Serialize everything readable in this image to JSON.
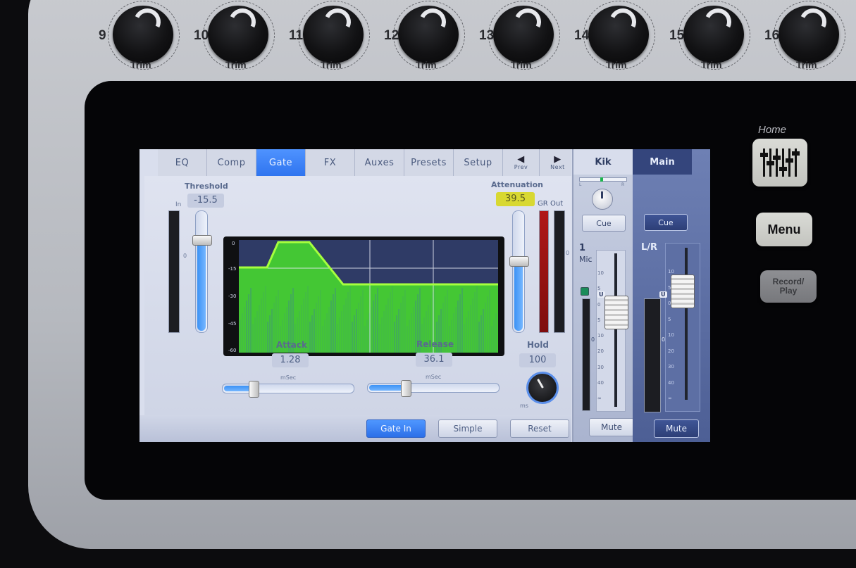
{
  "colors": {
    "active_tab": "#2f74ef",
    "gate_fill": "#44c734",
    "gate_curve": "#a6ff3e",
    "graph_bg": "#2f3b66",
    "attenuation_highlight": "#d8d832",
    "gr_meter": "#a51515"
  },
  "hardware": {
    "trim_knobs": [
      {
        "number": "9",
        "label": "Trim"
      },
      {
        "number": "10",
        "label": "Trim"
      },
      {
        "number": "11",
        "label": "Trim"
      },
      {
        "number": "12",
        "label": "Trim"
      },
      {
        "number": "13",
        "label": "Trim"
      },
      {
        "number": "14",
        "label": "Trim"
      },
      {
        "number": "15",
        "label": "Trim"
      },
      {
        "number": "16",
        "label": "Trim"
      }
    ],
    "home_label": "Home",
    "home_icon": "fader-bank-icon",
    "menu_label": "Menu",
    "record_label": "Record/\nPlay"
  },
  "tabs": [
    {
      "label": "EQ",
      "active": false
    },
    {
      "label": "Comp",
      "active": false
    },
    {
      "label": "Gate",
      "active": true
    },
    {
      "label": "FX",
      "active": false
    },
    {
      "label": "Auxes",
      "active": false
    },
    {
      "label": "Presets",
      "active": false
    },
    {
      "label": "Setup",
      "active": false
    }
  ],
  "nav": {
    "prev": {
      "arrow": "◀",
      "label": "Prev",
      "icon": "arrow-left-icon"
    },
    "next": {
      "arrow": "▶",
      "label": "Next",
      "icon": "arrow-right-icon"
    }
  },
  "gate": {
    "threshold_label": "Threshold",
    "threshold_value": "-15.5",
    "threshold_level": 0.78,
    "in_label": "In",
    "attenuation_label": "Attenuation",
    "attenuation_value": "39.5",
    "attenuation_level": 0.6,
    "gr_label": "GR",
    "out_label": "Out",
    "meter_zero": "0",
    "graph_y_ticks": [
      "0",
      "-15",
      "-30",
      "-45",
      "-60"
    ],
    "attack_label": "Attack",
    "attack_value": "1.28",
    "attack_unit": "mSec",
    "attack_level": 0.22,
    "release_label": "Release",
    "release_value": "36.1",
    "release_unit": "mSec",
    "release_level": 0.28,
    "hold_label": "Hold",
    "hold_value": "100",
    "hold_unit": "ms"
  },
  "buttons": {
    "gate_in": "Gate In",
    "simple": "Simple",
    "reset": "Reset"
  },
  "channel_strip": {
    "name": "Kik",
    "pan_scale_left": "L",
    "pan_scale_right": "R",
    "cue": "Cue",
    "number": "1",
    "input": "Mic",
    "unity": "U",
    "scale": [
      "10",
      "5",
      "0",
      "5",
      "10",
      "20",
      "30",
      "40",
      "∞"
    ],
    "meter_zero": "0",
    "mute": "Mute"
  },
  "main_strip": {
    "name": "Main",
    "cue": "Cue",
    "bus": "L/R",
    "unity": "U",
    "scale": [
      "10",
      "5",
      "0",
      "5",
      "10",
      "20",
      "30",
      "40",
      "∞"
    ],
    "meter_zero": "0",
    "mute": "Mute"
  }
}
